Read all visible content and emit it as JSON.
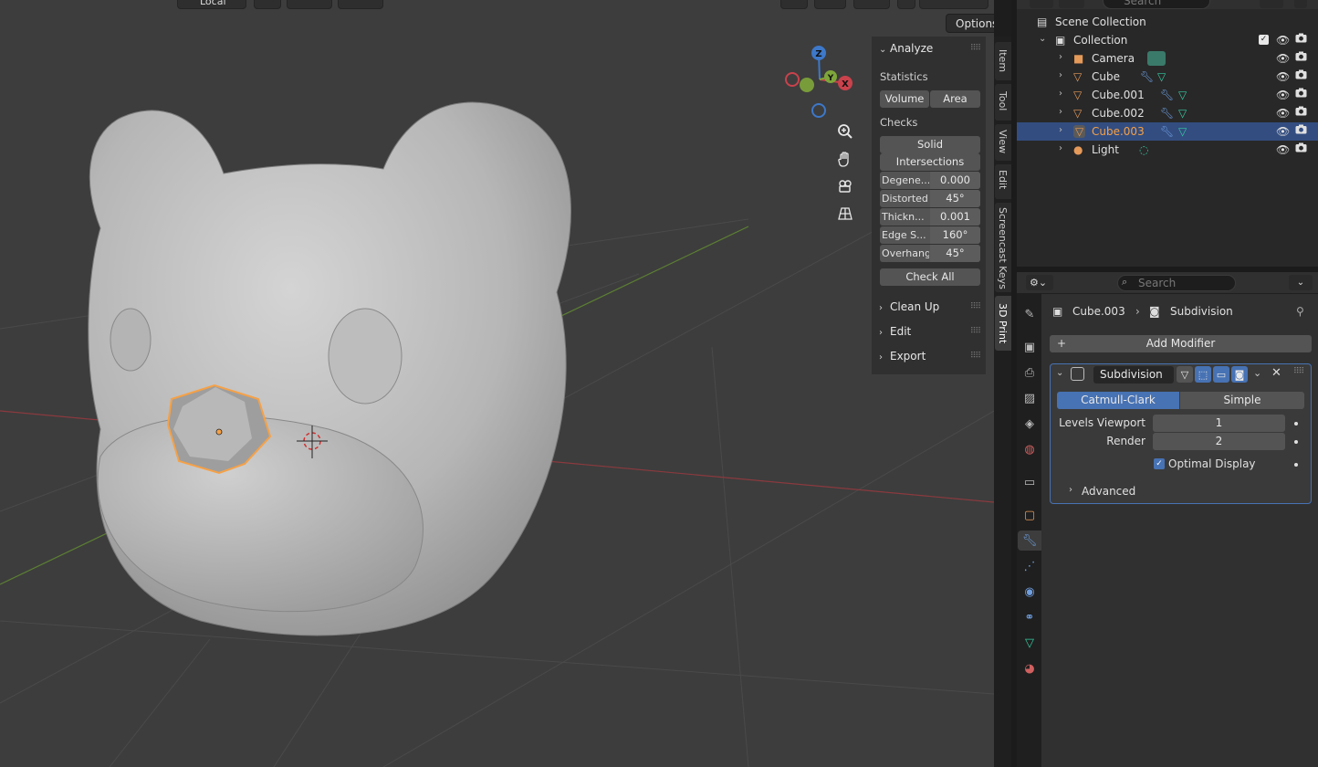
{
  "header": {
    "orientation_label": "Local",
    "options_label": "Options"
  },
  "gizmo": {
    "z": "Z",
    "y": "Y",
    "x": "X"
  },
  "npanel": {
    "analyze_title": "Analyze",
    "statistics_label": "Statistics",
    "volume_label": "Volume",
    "area_label": "Area",
    "checks_label": "Checks",
    "solid_label": "Solid",
    "intersections_label": "Intersections",
    "checks": [
      {
        "name": "Degene...",
        "value": "0.000"
      },
      {
        "name": "Distorted",
        "value": "45°"
      },
      {
        "name": "Thickn...",
        "value": "0.001"
      },
      {
        "name": "Edge S...",
        "value": "160°"
      },
      {
        "name": "Overhang",
        "value": "45°"
      }
    ],
    "check_all_label": "Check All",
    "sections": [
      "Clean Up",
      "Edit",
      "Export"
    ]
  },
  "sidetabs": [
    "Item",
    "Tool",
    "View",
    "Edit",
    "Screencast Keys",
    "3D Print"
  ],
  "outliner": {
    "search_placeholder": "Search",
    "scene_collection": "Scene Collection",
    "collection": "Collection",
    "items": [
      {
        "name": "Camera"
      },
      {
        "name": "Cube"
      },
      {
        "name": "Cube.001"
      },
      {
        "name": "Cube.002"
      },
      {
        "name": "Cube.003"
      },
      {
        "name": "Light"
      }
    ]
  },
  "properties": {
    "search_placeholder": "Search",
    "breadcrumb_object": "Cube.003",
    "breadcrumb_modifier": "Subdivision",
    "add_modifier_label": "Add Modifier",
    "modifier_name": "Subdivision",
    "catmull_clark_label": "Catmull-Clark",
    "simple_label": "Simple",
    "levels_viewport_label": "Levels Viewport",
    "levels_viewport_value": "1",
    "render_label": "Render",
    "render_value": "2",
    "optimal_display_label": "Optimal Display",
    "advanced_label": "Advanced"
  },
  "colors": {
    "selection_orange": "#f5a147",
    "selected_row": "#334d80",
    "accent_blue": "#4772b3",
    "x_axis_red": "#b3353e",
    "y_axis_green": "#6c9c2d"
  }
}
